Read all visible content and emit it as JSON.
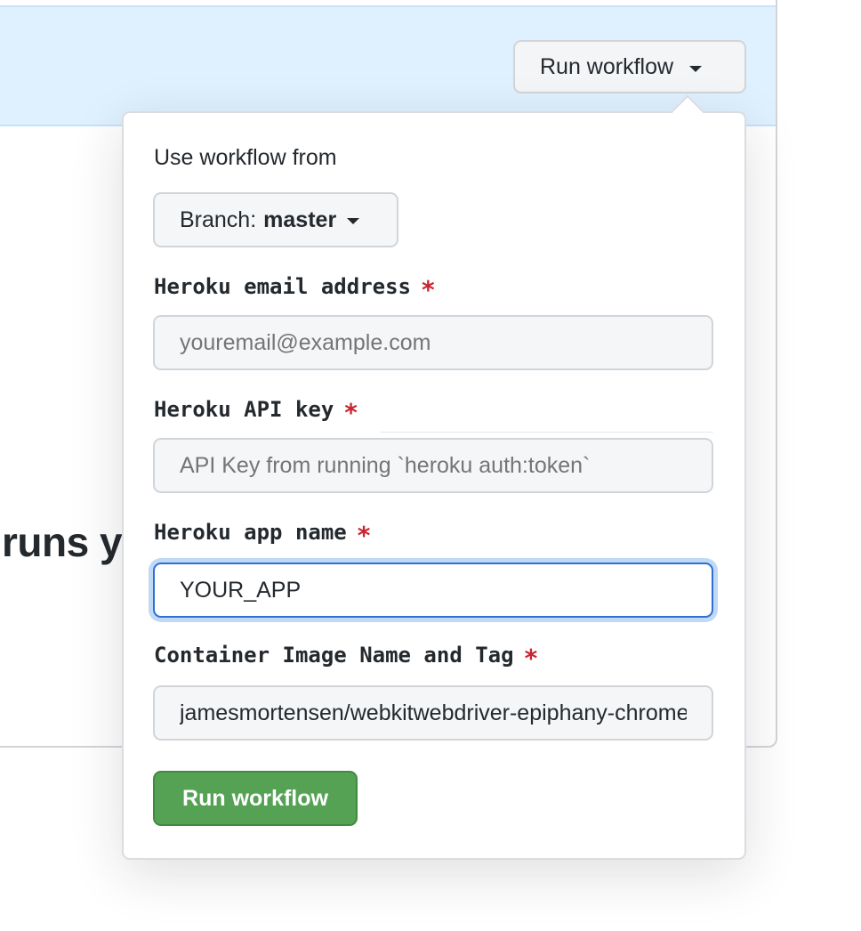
{
  "background": {
    "heading_fragment": "runs y"
  },
  "trigger": {
    "label": "Run workflow",
    "caret_icon": "caret-down-icon"
  },
  "popover": {
    "use_from_label": "Use workflow from",
    "branch": {
      "prefix": "Branch:",
      "name": "master"
    },
    "fields": [
      {
        "label": "Heroku email address",
        "required_mark": "*",
        "value": "",
        "placeholder": "youremail@example.com"
      },
      {
        "label": "Heroku API key",
        "required_mark": "*",
        "value": "",
        "placeholder": "API Key from running `heroku auth:token`"
      },
      {
        "label": "Heroku app name",
        "required_mark": "*",
        "value": "YOUR_APP",
        "placeholder": ""
      },
      {
        "label": "Container Image Name and Tag",
        "required_mark": "*",
        "value": "jamesmortensen/webkitwebdriver-epiphany-chrome:latest",
        "placeholder": ""
      }
    ],
    "submit_label": "Run workflow"
  },
  "colors": {
    "banner_bg": "#dff0fe",
    "submit_green": "#55a255",
    "required_red": "#cb2431",
    "focus_blue": "#2f6fd6"
  }
}
